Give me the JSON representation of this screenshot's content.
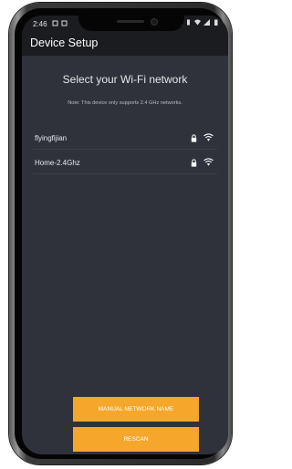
{
  "status_bar": {
    "time": "2:46",
    "left_icons": [
      "notification-icon",
      "notification-icon"
    ],
    "right_icons": [
      "nfc-icon",
      "vibrate-icon",
      "wifi-icon",
      "signal-icon",
      "battery-icon"
    ]
  },
  "app_bar": {
    "title": "Device Setup"
  },
  "main": {
    "heading": "Select your Wi-Fi network",
    "note": "Note: This device only supports 2.4 GHz networks.",
    "networks": [
      {
        "name": "flyingfijian",
        "secured": true,
        "icon": "wifi-icon"
      },
      {
        "name": "Home-2.4Ghz",
        "secured": true,
        "icon": "wifi-icon"
      }
    ]
  },
  "buttons": {
    "manual_label": "MANUAL NETWORK NAME",
    "rescan_label": "RESCAN"
  },
  "colors": {
    "background": "#2f323a",
    "appbar": "#1b1c20",
    "accent": "#f4a72a",
    "divider": "#3c4048"
  }
}
